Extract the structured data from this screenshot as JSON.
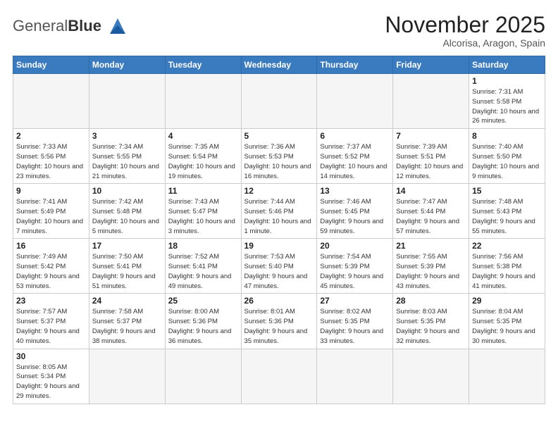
{
  "logo": {
    "text_general": "General",
    "text_blue": "Blue"
  },
  "header": {
    "month_title": "November 2025",
    "location": "Alcorisa, Aragon, Spain"
  },
  "weekdays": [
    "Sunday",
    "Monday",
    "Tuesday",
    "Wednesday",
    "Thursday",
    "Friday",
    "Saturday"
  ],
  "weeks": [
    [
      {
        "day": "",
        "info": ""
      },
      {
        "day": "",
        "info": ""
      },
      {
        "day": "",
        "info": ""
      },
      {
        "day": "",
        "info": ""
      },
      {
        "day": "",
        "info": ""
      },
      {
        "day": "",
        "info": ""
      },
      {
        "day": "1",
        "info": "Sunrise: 7:31 AM\nSunset: 5:58 PM\nDaylight: 10 hours and 26 minutes."
      }
    ],
    [
      {
        "day": "2",
        "info": "Sunrise: 7:33 AM\nSunset: 5:56 PM\nDaylight: 10 hours and 23 minutes."
      },
      {
        "day": "3",
        "info": "Sunrise: 7:34 AM\nSunset: 5:55 PM\nDaylight: 10 hours and 21 minutes."
      },
      {
        "day": "4",
        "info": "Sunrise: 7:35 AM\nSunset: 5:54 PM\nDaylight: 10 hours and 19 minutes."
      },
      {
        "day": "5",
        "info": "Sunrise: 7:36 AM\nSunset: 5:53 PM\nDaylight: 10 hours and 16 minutes."
      },
      {
        "day": "6",
        "info": "Sunrise: 7:37 AM\nSunset: 5:52 PM\nDaylight: 10 hours and 14 minutes."
      },
      {
        "day": "7",
        "info": "Sunrise: 7:39 AM\nSunset: 5:51 PM\nDaylight: 10 hours and 12 minutes."
      },
      {
        "day": "8",
        "info": "Sunrise: 7:40 AM\nSunset: 5:50 PM\nDaylight: 10 hours and 9 minutes."
      }
    ],
    [
      {
        "day": "9",
        "info": "Sunrise: 7:41 AM\nSunset: 5:49 PM\nDaylight: 10 hours and 7 minutes."
      },
      {
        "day": "10",
        "info": "Sunrise: 7:42 AM\nSunset: 5:48 PM\nDaylight: 10 hours and 5 minutes."
      },
      {
        "day": "11",
        "info": "Sunrise: 7:43 AM\nSunset: 5:47 PM\nDaylight: 10 hours and 3 minutes."
      },
      {
        "day": "12",
        "info": "Sunrise: 7:44 AM\nSunset: 5:46 PM\nDaylight: 10 hours and 1 minute."
      },
      {
        "day": "13",
        "info": "Sunrise: 7:46 AM\nSunset: 5:45 PM\nDaylight: 9 hours and 59 minutes."
      },
      {
        "day": "14",
        "info": "Sunrise: 7:47 AM\nSunset: 5:44 PM\nDaylight: 9 hours and 57 minutes."
      },
      {
        "day": "15",
        "info": "Sunrise: 7:48 AM\nSunset: 5:43 PM\nDaylight: 9 hours and 55 minutes."
      }
    ],
    [
      {
        "day": "16",
        "info": "Sunrise: 7:49 AM\nSunset: 5:42 PM\nDaylight: 9 hours and 53 minutes."
      },
      {
        "day": "17",
        "info": "Sunrise: 7:50 AM\nSunset: 5:41 PM\nDaylight: 9 hours and 51 minutes."
      },
      {
        "day": "18",
        "info": "Sunrise: 7:52 AM\nSunset: 5:41 PM\nDaylight: 9 hours and 49 minutes."
      },
      {
        "day": "19",
        "info": "Sunrise: 7:53 AM\nSunset: 5:40 PM\nDaylight: 9 hours and 47 minutes."
      },
      {
        "day": "20",
        "info": "Sunrise: 7:54 AM\nSunset: 5:39 PM\nDaylight: 9 hours and 45 minutes."
      },
      {
        "day": "21",
        "info": "Sunrise: 7:55 AM\nSunset: 5:39 PM\nDaylight: 9 hours and 43 minutes."
      },
      {
        "day": "22",
        "info": "Sunrise: 7:56 AM\nSunset: 5:38 PM\nDaylight: 9 hours and 41 minutes."
      }
    ],
    [
      {
        "day": "23",
        "info": "Sunrise: 7:57 AM\nSunset: 5:37 PM\nDaylight: 9 hours and 40 minutes."
      },
      {
        "day": "24",
        "info": "Sunrise: 7:58 AM\nSunset: 5:37 PM\nDaylight: 9 hours and 38 minutes."
      },
      {
        "day": "25",
        "info": "Sunrise: 8:00 AM\nSunset: 5:36 PM\nDaylight: 9 hours and 36 minutes."
      },
      {
        "day": "26",
        "info": "Sunrise: 8:01 AM\nSunset: 5:36 PM\nDaylight: 9 hours and 35 minutes."
      },
      {
        "day": "27",
        "info": "Sunrise: 8:02 AM\nSunset: 5:35 PM\nDaylight: 9 hours and 33 minutes."
      },
      {
        "day": "28",
        "info": "Sunrise: 8:03 AM\nSunset: 5:35 PM\nDaylight: 9 hours and 32 minutes."
      },
      {
        "day": "29",
        "info": "Sunrise: 8:04 AM\nSunset: 5:35 PM\nDaylight: 9 hours and 30 minutes."
      }
    ],
    [
      {
        "day": "30",
        "info": "Sunrise: 8:05 AM\nSunset: 5:34 PM\nDaylight: 9 hours and 29 minutes."
      },
      {
        "day": "",
        "info": ""
      },
      {
        "day": "",
        "info": ""
      },
      {
        "day": "",
        "info": ""
      },
      {
        "day": "",
        "info": ""
      },
      {
        "day": "",
        "info": ""
      },
      {
        "day": "",
        "info": ""
      }
    ]
  ]
}
